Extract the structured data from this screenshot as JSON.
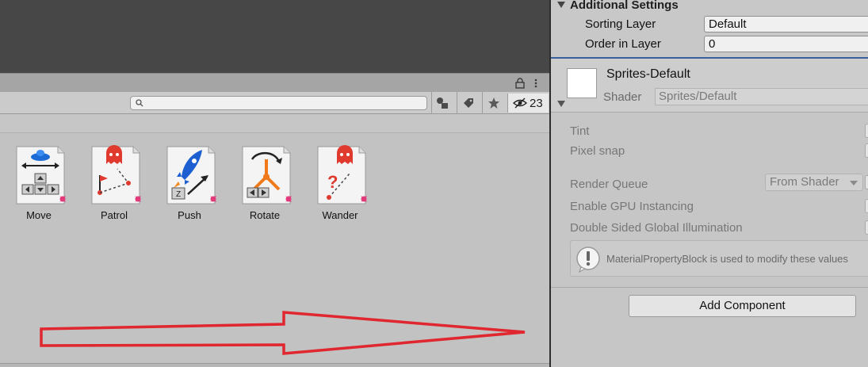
{
  "project": {
    "search": {
      "value": "",
      "placeholder": ""
    },
    "hidden_count": "23",
    "assets": [
      {
        "label": "Move",
        "icon": "move-behavior-icon"
      },
      {
        "label": "Patrol",
        "icon": "patrol-behavior-icon"
      },
      {
        "label": "Push",
        "icon": "push-behavior-icon"
      },
      {
        "label": "Rotate",
        "icon": "rotate-behavior-icon"
      },
      {
        "label": "Wander",
        "icon": "wander-behavior-icon"
      }
    ],
    "annotation_color": "#e0262e"
  },
  "inspector": {
    "additional_settings": {
      "title": "Additional Settings",
      "sorting_layer_label": "Sorting Layer",
      "sorting_layer_value": "Default",
      "order_label": "Order in Layer",
      "order_value": "0"
    },
    "material": {
      "name": "Sprites-Default",
      "shader_label": "Shader",
      "shader_value": "Sprites/Default",
      "accent_color": "#3b5f9c"
    },
    "properties": {
      "tint": "Tint",
      "pixel_snap": "Pixel snap",
      "render_queue": "Render Queue",
      "render_queue_value": "From Shader",
      "gpu_instancing": "Enable GPU Instancing",
      "double_sided": "Double Sided Global Illumination",
      "info_message": "MaterialPropertyBlock is used to modify these values"
    },
    "add_component": "Add Component"
  }
}
